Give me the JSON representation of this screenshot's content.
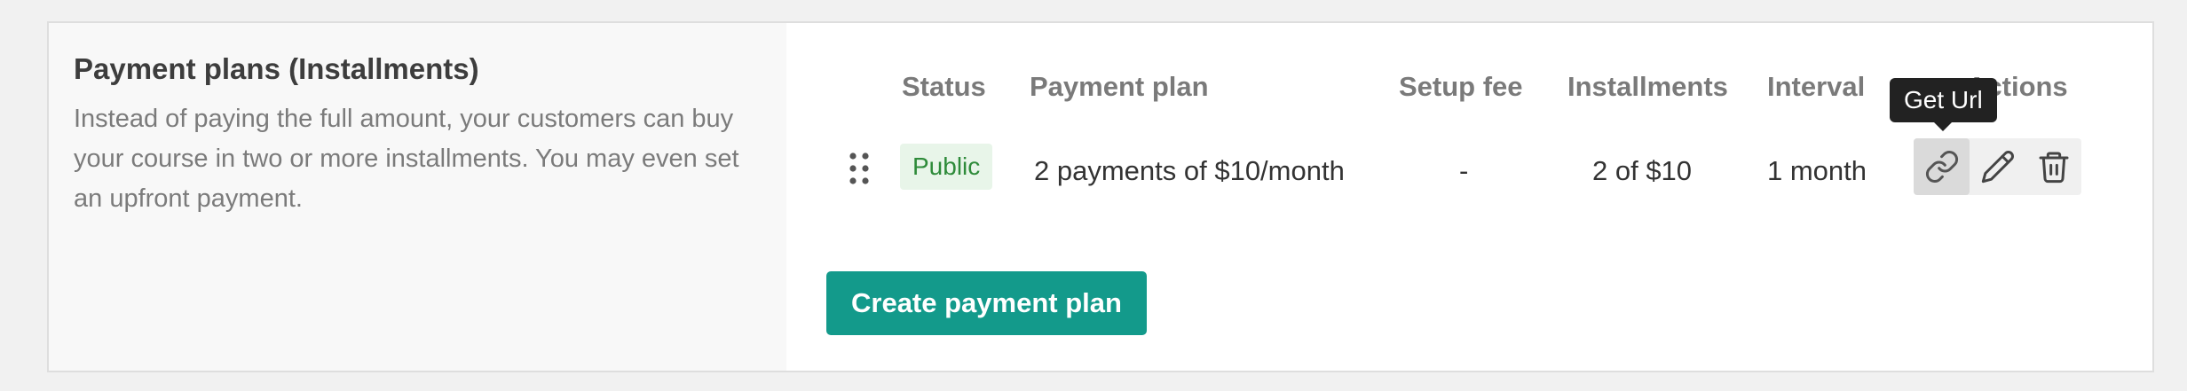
{
  "section": {
    "title": "Payment plans (Installments)",
    "description": "Instead of paying the full amount, your customers can buy your course in two or more installments. You may even set an upfront payment."
  },
  "table": {
    "headers": {
      "status": "Status",
      "payment_plan": "Payment plan",
      "setup_fee": "Setup fee",
      "installments": "Installments",
      "interval": "Interval",
      "actions": "Actions"
    },
    "rows": [
      {
        "status": "Public",
        "payment_plan": "2 payments of $10/month",
        "setup_fee": "-",
        "installments": "2 of $10",
        "interval": "1 month"
      }
    ]
  },
  "tooltip": {
    "text": "Get Url"
  },
  "icons": [
    "drag-handle-icon",
    "link-icon",
    "pencil-icon",
    "trash-icon"
  ],
  "create_button": {
    "label": "Create payment plan"
  },
  "colors": {
    "accent": "#139a8b",
    "badge_bg": "#e8f5e9",
    "badge_text": "#2e8b3a",
    "tooltip_bg": "#222222"
  }
}
